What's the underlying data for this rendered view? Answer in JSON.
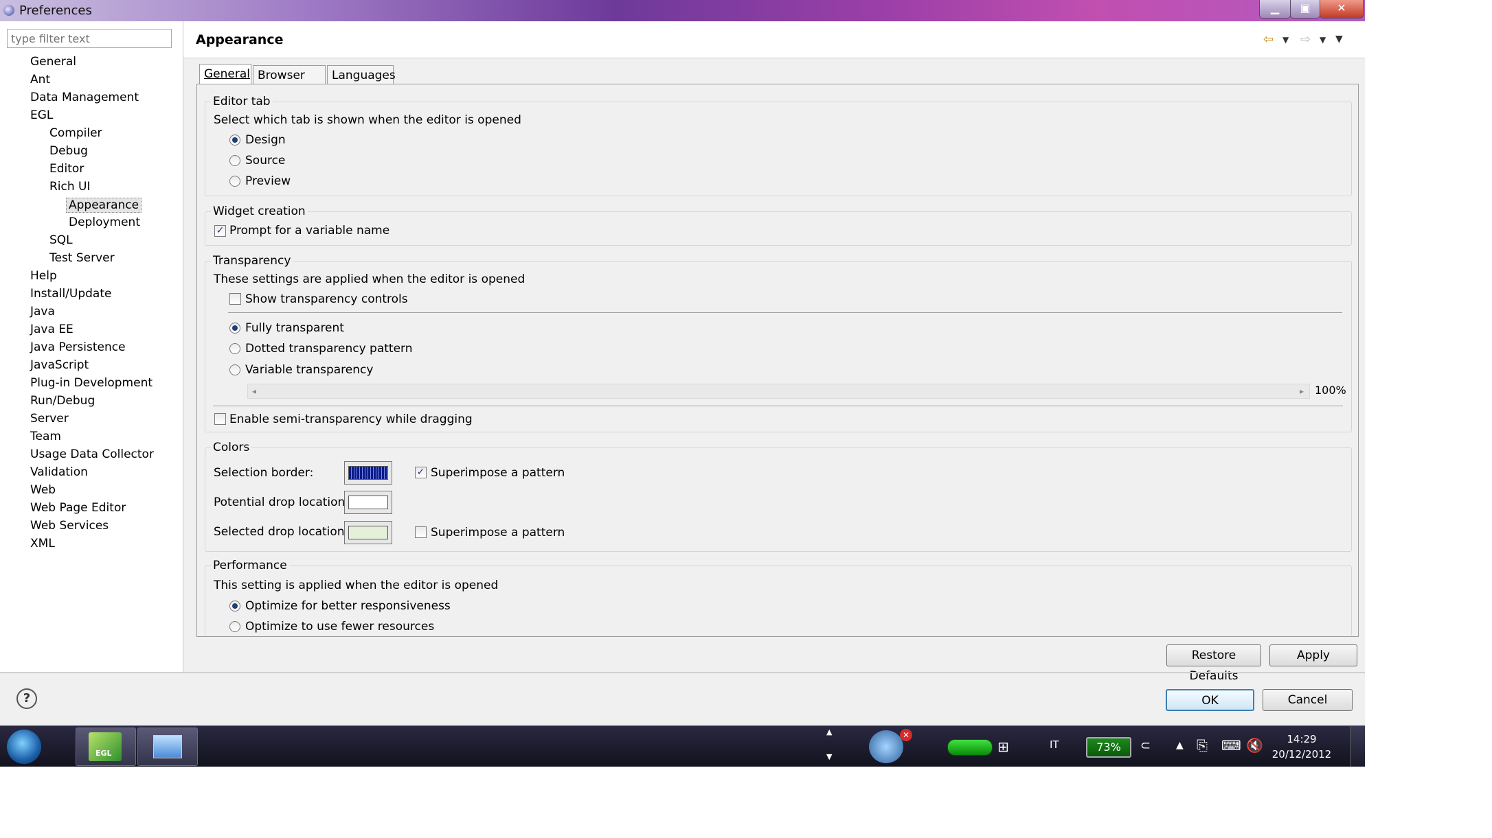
{
  "window": {
    "title": "Preferences"
  },
  "sidebar": {
    "filter_placeholder": "type filter text",
    "items": [
      {
        "label": "General",
        "level": 0
      },
      {
        "label": "Ant",
        "level": 0
      },
      {
        "label": "Data Management",
        "level": 0
      },
      {
        "label": "EGL",
        "level": 0
      },
      {
        "label": "Compiler",
        "level": 1
      },
      {
        "label": "Debug",
        "level": 1
      },
      {
        "label": "Editor",
        "level": 1
      },
      {
        "label": "Rich UI",
        "level": 1
      },
      {
        "label": "Appearance",
        "level": 2,
        "selected": true
      },
      {
        "label": "Deployment",
        "level": 2
      },
      {
        "label": "SQL",
        "level": 1
      },
      {
        "label": "Test Server",
        "level": 1
      },
      {
        "label": "Help",
        "level": 0
      },
      {
        "label": "Install/Update",
        "level": 0
      },
      {
        "label": "Java",
        "level": 0
      },
      {
        "label": "Java EE",
        "level": 0
      },
      {
        "label": "Java Persistence",
        "level": 0
      },
      {
        "label": "JavaScript",
        "level": 0
      },
      {
        "label": "Plug-in Development",
        "level": 0
      },
      {
        "label": "Run/Debug",
        "level": 0
      },
      {
        "label": "Server",
        "level": 0
      },
      {
        "label": "Team",
        "level": 0
      },
      {
        "label": "Usage Data Collector",
        "level": 0
      },
      {
        "label": "Validation",
        "level": 0
      },
      {
        "label": "Web",
        "level": 0
      },
      {
        "label": "Web Page Editor",
        "level": 0
      },
      {
        "label": "Web Services",
        "level": 0
      },
      {
        "label": "XML",
        "level": 0
      }
    ]
  },
  "page": {
    "title": "Appearance",
    "tabs": [
      "General",
      "Browser size",
      "Languages"
    ],
    "active_tab": "General"
  },
  "editor_tab": {
    "legend": "Editor tab",
    "description": "Select which tab is shown when the editor is opened",
    "options": [
      {
        "label": "Design",
        "checked": true
      },
      {
        "label": "Source",
        "checked": false
      },
      {
        "label": "Preview",
        "checked": false
      }
    ]
  },
  "widget_creation": {
    "legend": "Widget creation",
    "prompt_label": "Prompt for a variable name",
    "prompt_checked": true
  },
  "transparency": {
    "legend": "Transparency",
    "description": "These settings are applied when the editor is opened",
    "show_controls_label": "Show transparency controls",
    "show_controls_checked": false,
    "options": [
      {
        "label": "Fully transparent",
        "checked": true
      },
      {
        "label": "Dotted transparency pattern",
        "checked": false
      },
      {
        "label": "Variable transparency",
        "checked": false
      }
    ],
    "slider_value": "100%",
    "semi_label": "Enable semi-transparency while dragging",
    "semi_checked": false
  },
  "colors": {
    "legend": "Colors",
    "selection_border_label": "Selection border:",
    "selection_border_color": "#0a1a8a",
    "potential_drop_label": "Potential drop location:",
    "potential_drop_color": "#ffffff",
    "selected_drop_label": "Selected drop location:",
    "selected_drop_color": "#e4f0d8",
    "superimpose_label": "Superimpose a pattern",
    "superimpose_1_checked": true,
    "superimpose_2_checked": false
  },
  "performance": {
    "legend": "Performance",
    "description": "This setting is applied when the editor is opened",
    "options": [
      {
        "label": "Optimize for better responsiveness",
        "checked": true
      },
      {
        "label": "Optimize to use fewer resources",
        "checked": false
      }
    ]
  },
  "buttons": {
    "restore_defaults": "Restore Defaults",
    "apply": "Apply",
    "ok": "OK",
    "cancel": "Cancel"
  },
  "taskbar": {
    "language": "IT",
    "battery": "73%",
    "time": "14:29",
    "date": "20/12/2012",
    "egl_label": "EGL"
  }
}
